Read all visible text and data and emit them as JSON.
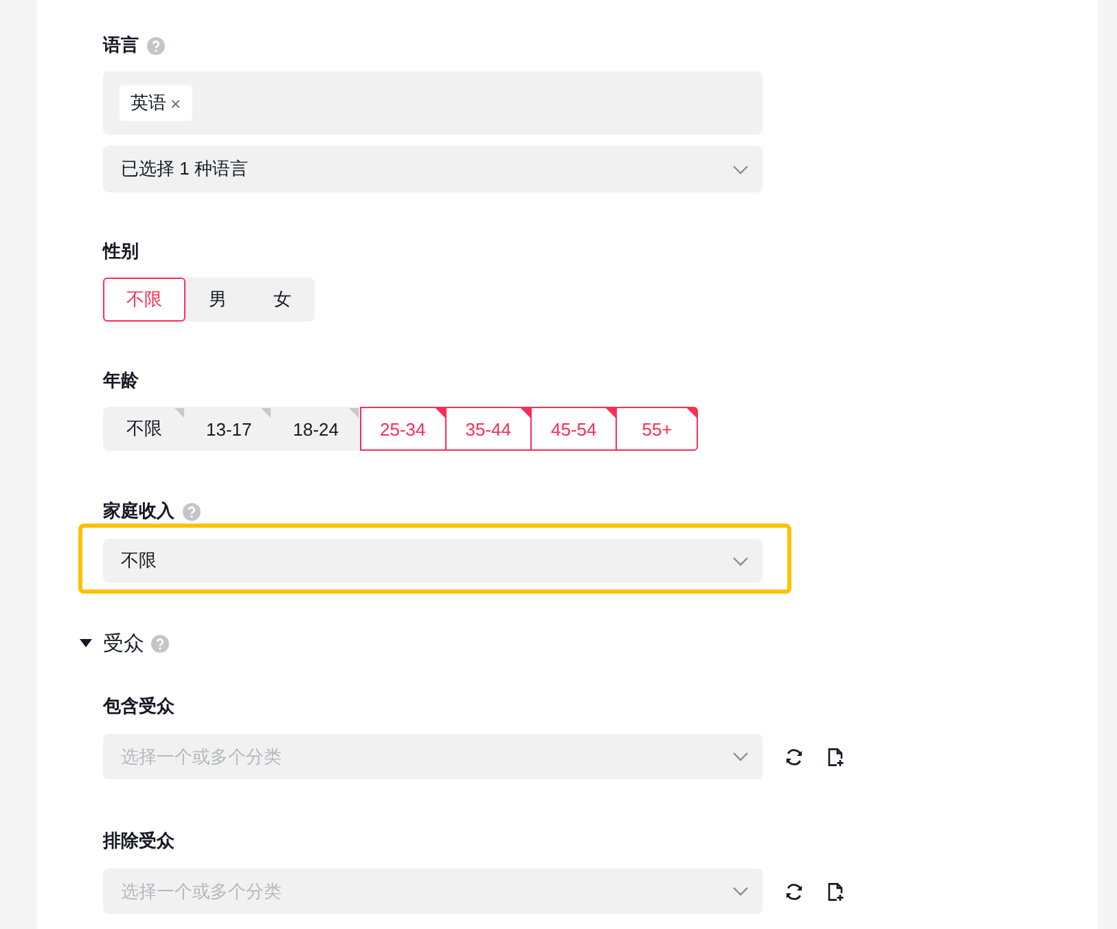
{
  "language": {
    "label": "语言",
    "tags": [
      {
        "label": "英语",
        "remove": "×"
      }
    ],
    "dropdown": {
      "value": "已选择 1 种语言"
    }
  },
  "gender": {
    "label": "性别",
    "options": [
      {
        "label": "不限",
        "selected": true
      },
      {
        "label": "男",
        "selected": false
      },
      {
        "label": "女",
        "selected": false
      }
    ]
  },
  "age": {
    "label": "年龄",
    "options": [
      {
        "label": "不限",
        "selected": false
      },
      {
        "label": "13-17",
        "selected": false
      },
      {
        "label": "18-24",
        "selected": false
      },
      {
        "label": "25-34",
        "selected": true
      },
      {
        "label": "35-44",
        "selected": true
      },
      {
        "label": "45-54",
        "selected": true
      },
      {
        "label": "55+",
        "selected": true
      }
    ]
  },
  "household_income": {
    "label": "家庭收入",
    "value": "不限",
    "highlighted": true
  },
  "audience": {
    "title": "受众",
    "expanded": true,
    "fields": [
      {
        "label": "包含受众",
        "placeholder": "选择一个或多个分类"
      },
      {
        "label": "排除受众",
        "placeholder": "选择一个或多个分类"
      }
    ]
  }
}
